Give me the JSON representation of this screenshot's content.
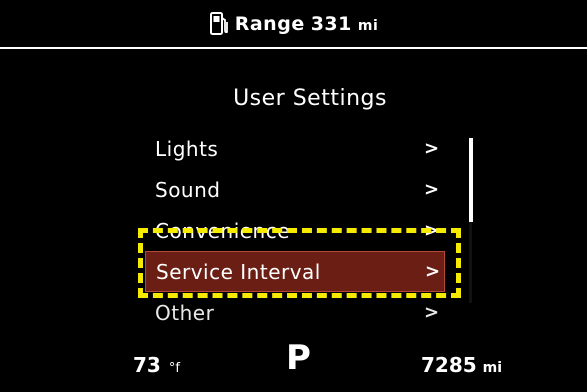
{
  "header": {
    "icon": "fuel-pump-icon",
    "range_label": "Range",
    "range_value": "331",
    "range_unit": "mi"
  },
  "screen": {
    "title": "User Settings"
  },
  "menu": {
    "items": [
      {
        "label": "Lights",
        "chevron": ">"
      },
      {
        "label": "Sound",
        "chevron": ">"
      },
      {
        "label": "Convenience",
        "chevron": ">"
      },
      {
        "label": "Service Interval",
        "chevron": ">",
        "selected": true
      },
      {
        "label": "Other",
        "chevron": ">"
      }
    ]
  },
  "footer": {
    "temperature_value": "73",
    "temperature_unit": "°f",
    "gear": "P",
    "odometer_value": "7285",
    "odometer_unit": "mi"
  },
  "colors": {
    "background": "#000000",
    "selected_row": "#6b1f14",
    "highlight_callout": "#f5ea00",
    "text": "#ffffff"
  }
}
